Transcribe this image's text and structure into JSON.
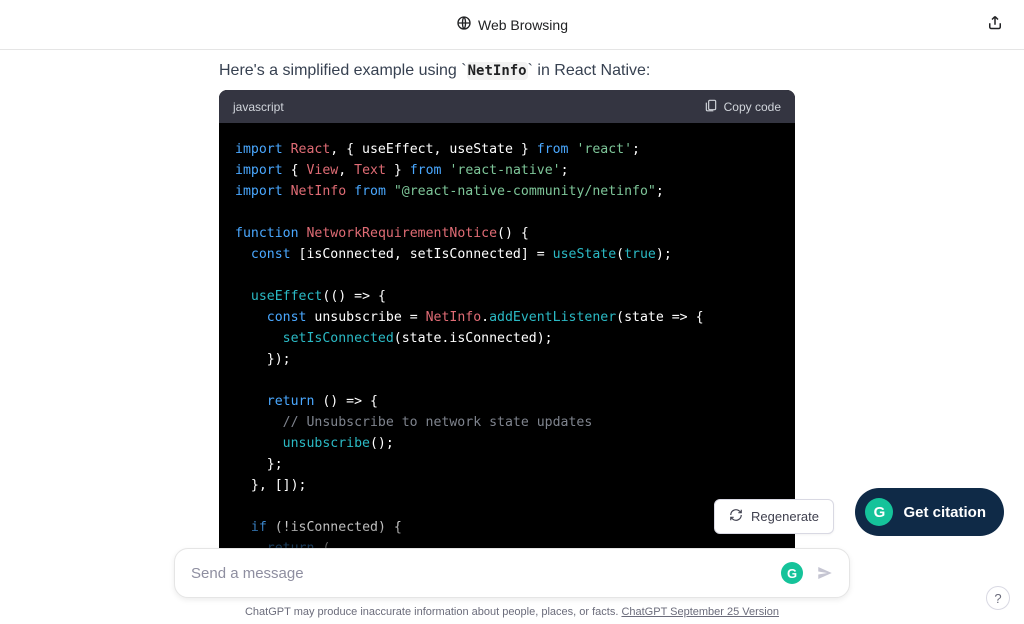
{
  "topbar": {
    "title": "Web Browsing"
  },
  "intro": {
    "prefix": "Here's a simplified example using ",
    "code": "NetInfo",
    "suffix": " in React Native:"
  },
  "code": {
    "language": "javascript",
    "copy_label": "Copy code"
  },
  "regenerate": {
    "label": "Regenerate"
  },
  "citation": {
    "label": "Get citation",
    "glyph": "G"
  },
  "composer": {
    "placeholder": "Send a message",
    "glyph": "G"
  },
  "disclaimer": {
    "text": "ChatGPT may produce inaccurate information about people, places, or facts. ",
    "link": "ChatGPT September 25 Version"
  },
  "help_glyph": "?"
}
